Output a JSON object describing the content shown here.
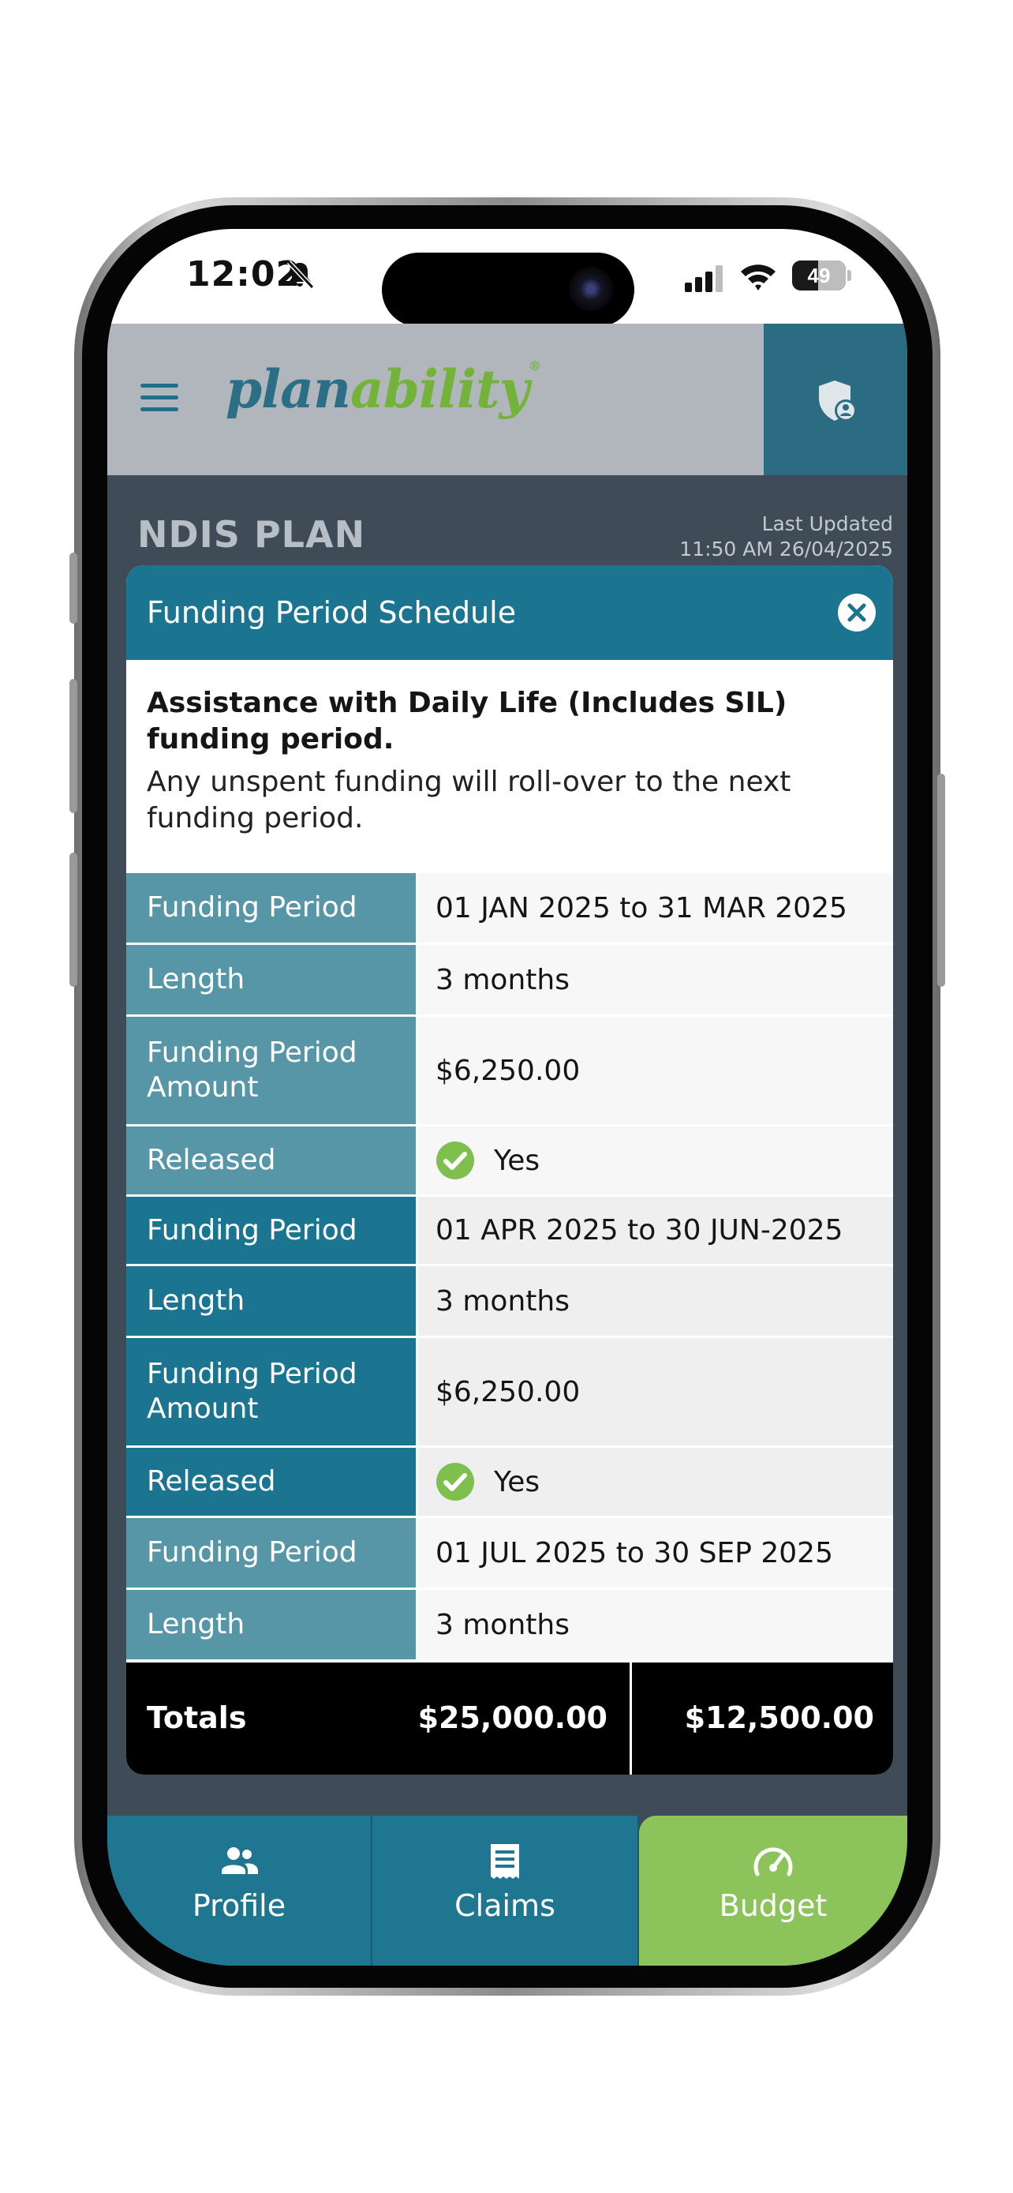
{
  "status_bar": {
    "time": "12:02",
    "battery": "49",
    "battery_level": 0.49,
    "icons": [
      "bell-slash-icon",
      "cellular-signal-icon",
      "wifi-icon",
      "battery-icon"
    ]
  },
  "header": {
    "logo_part1": "plan",
    "logo_part2": "ability",
    "logo_mark": "®",
    "menu_icon": "hamburger-menu-icon",
    "account_icon": "shield-user-icon"
  },
  "page": {
    "title": "NDIS PLAN",
    "last_updated_label": "Last Updated",
    "last_updated_value": "11:50 AM 26/04/2025"
  },
  "modal": {
    "title": "Funding Period Schedule",
    "close_icon": "close-x-icon",
    "intro_title": "Assistance with Daily Life (Includes SIL) funding period.",
    "intro_text": "Any unspent funding will roll-over to the next funding period.",
    "rows": [
      {
        "label": "Funding Period",
        "value": "01 JAN 2025 to 31 MAR 2025"
      },
      {
        "label": "Length",
        "value": "3 months"
      },
      {
        "label": "Funding Period Amount",
        "value": "$6,250.00"
      },
      {
        "label": "Released",
        "value": "Yes",
        "icon": "check-circle-icon"
      },
      {
        "label": "Funding Period",
        "value": "01 APR 2025 to 30 JUN-2025"
      },
      {
        "label": "Length",
        "value": "3 months"
      },
      {
        "label": "Funding Period Amount",
        "value": "$6,250.00"
      },
      {
        "label": "Released",
        "value": "Yes",
        "icon": "check-circle-icon"
      },
      {
        "label": "Funding Period",
        "value": "01 JUL 2025 to 30 SEP 2025"
      },
      {
        "label": "Length",
        "value": "3 months"
      }
    ],
    "totals": {
      "label": "Totals",
      "total_amount": "$25,000.00",
      "released_amount": "$12,500.00"
    }
  },
  "nav": {
    "items": [
      {
        "label": "Profile",
        "icon": "people-icon"
      },
      {
        "label": "Claims",
        "icon": "receipt-icon"
      },
      {
        "label": "Budget",
        "icon": "gauge-icon"
      }
    ],
    "active": "Budget"
  },
  "colors": {
    "brand_teal": "#1b7590",
    "brand_green": "#8cc35b",
    "header_gray": "#b1b6bc",
    "check_green": "#7fbf4d"
  }
}
